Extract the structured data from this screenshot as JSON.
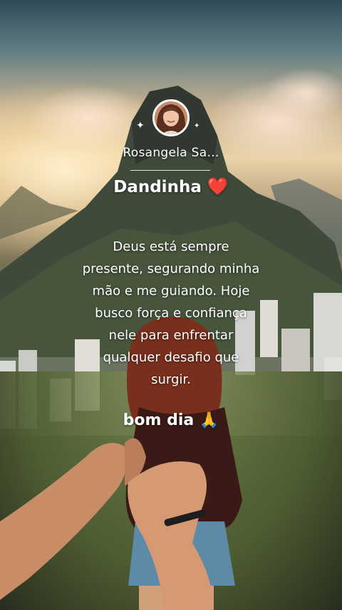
{
  "profile": {
    "username": "Rosangela Sa...",
    "nickname": "Dandinha",
    "nickname_emoji": "❤️"
  },
  "post": {
    "message_lines": [
      "Deus está sempre",
      "presente, segurando minha",
      "mão e me guiando. Hoje",
      "busco força e confiança",
      "nele para enfrentar",
      "qualquer desafio que",
      "surgir."
    ],
    "greeting": "bom dia",
    "greeting_emoji": "🙏"
  },
  "icons": {
    "sparkle": "✦",
    "avatar": "avatar-icon"
  },
  "colors": {
    "text": "#ffffff",
    "heart": "#e3121b"
  }
}
